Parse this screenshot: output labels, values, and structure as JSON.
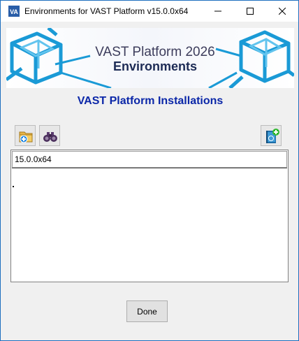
{
  "window": {
    "title": "Environments for VAST Platform v15.0.0x64",
    "app_icon_text": "VA"
  },
  "banner": {
    "line1": "VAST Platform 2026",
    "line2": "Environments"
  },
  "heading": "VAST Platform Installations",
  "toolbar": {
    "add_icon": "folder-add-icon",
    "find_icon": "binoculars-icon",
    "environment_icon": "book-add-icon"
  },
  "installations": [
    {
      "label": "15.0.0x64"
    }
  ],
  "buttons": {
    "done_label": "Done"
  },
  "colors": {
    "heading": "#0b27a8",
    "window_border": "#1e6fbf",
    "banner_accent": "#1a9ad6"
  }
}
